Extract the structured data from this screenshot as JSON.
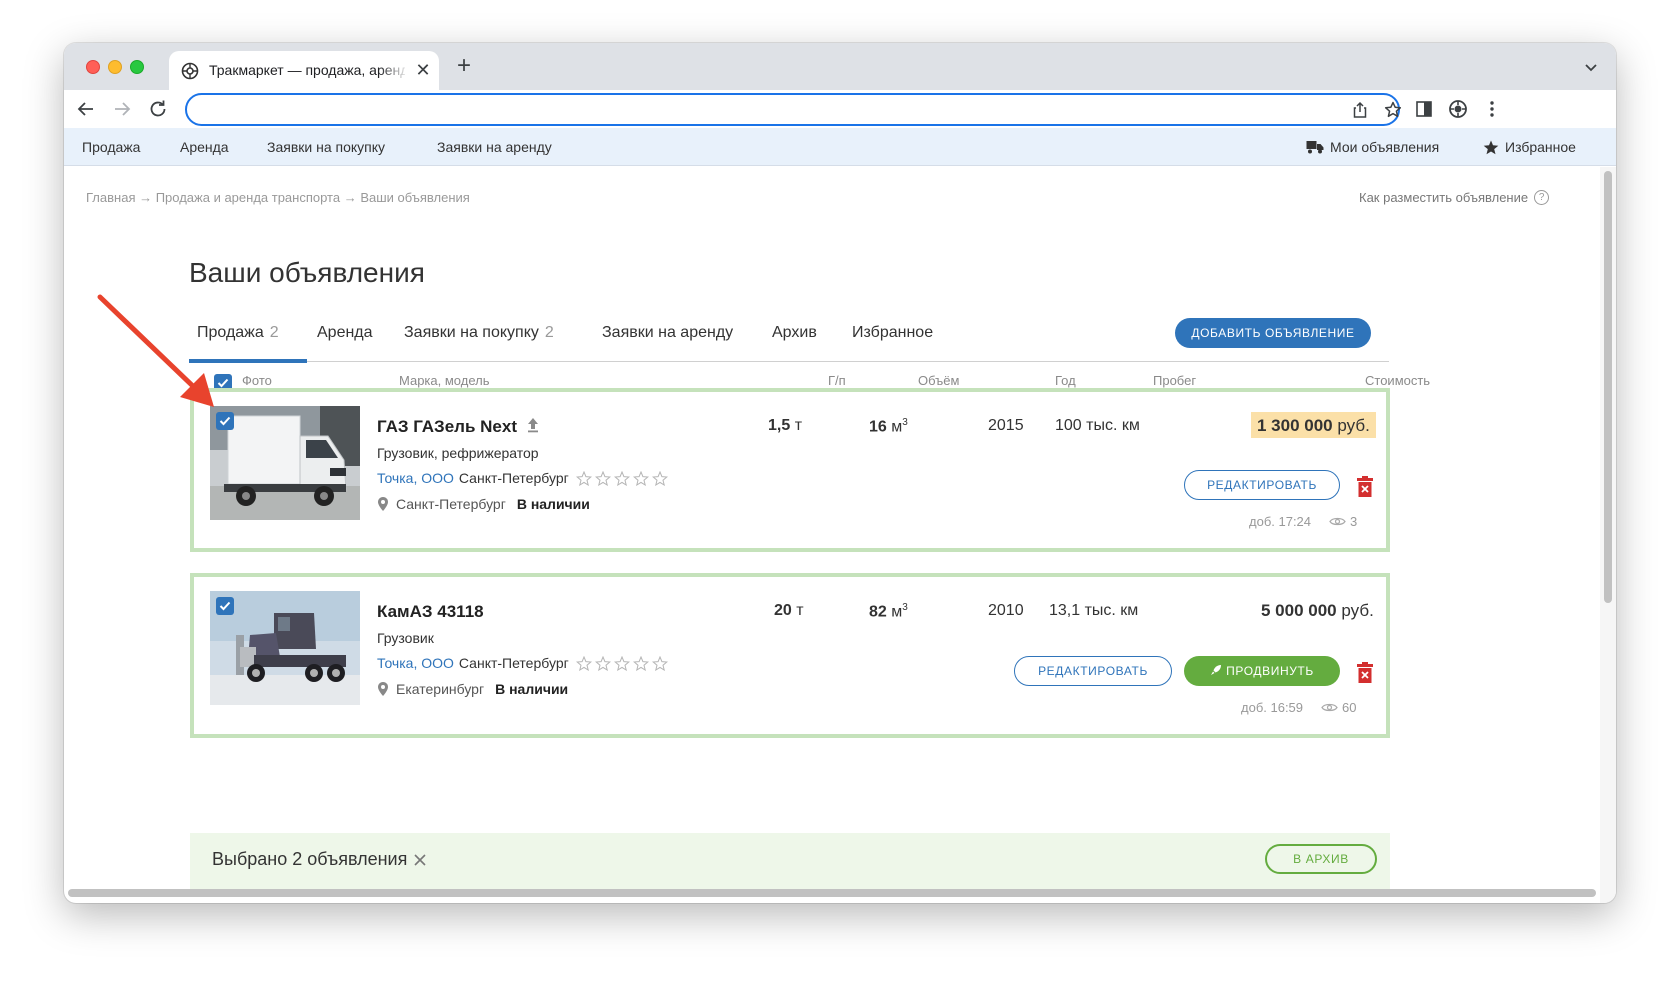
{
  "browser": {
    "tab_title": "Тракмаркет — продажа, аренда",
    "new_tab": "+",
    "close_tab": "✕",
    "address": ""
  },
  "site_nav": {
    "items": [
      "Продажа",
      "Аренда",
      "Заявки на покупку",
      "Заявки на аренду"
    ],
    "my_ads": "Мои объявления",
    "favorites": "Избранное"
  },
  "breadcrumb": "Главная → Продажа и аренда транспорта → Ваши объявления",
  "how_to": "Как разместить объявление",
  "how_to_icon": "?",
  "page_title": "Ваши объявления",
  "tabs": [
    {
      "label": "Продажа",
      "count": "2",
      "active": true
    },
    {
      "label": "Аренда",
      "count": ""
    },
    {
      "label": "Заявки на покупку",
      "count": "2"
    },
    {
      "label": "Заявки на аренду",
      "count": ""
    },
    {
      "label": "Архив",
      "count": ""
    },
    {
      "label": "Избранное",
      "count": ""
    }
  ],
  "add_button": "ДОБАВИТЬ ОБЪЯВЛЕНИЕ",
  "columns": {
    "photo": "Фото",
    "model": "Марка, модель",
    "payload": "Г/п",
    "volume": "Объём",
    "year": "Год",
    "mileage": "Пробег",
    "price": "Стоимость"
  },
  "select_all_checked": true,
  "ads": [
    {
      "title": "ГАЗ ГАЗель Next",
      "subtitle": "Грузовик, рефрижератор",
      "company": "Точка, ООО",
      "seller_city": "Санкт-Петербург",
      "rating": 0,
      "location": "Санкт-Петербург",
      "availability": "В наличии",
      "payload_value": "1,5",
      "payload_unit": "т",
      "volume_value": "16",
      "volume_unit": "м",
      "volume_exp": "3",
      "year": "2015",
      "mileage": "100 тыс. км",
      "price_value": "1 300 000",
      "price_unit": "руб.",
      "edit_label": "РЕДАКТИРОВАТЬ",
      "promote_label": "",
      "added": "доб. 17:24",
      "views": "3",
      "checked": true
    },
    {
      "title": "КамАЗ 43118",
      "subtitle": "Грузовик",
      "company": "Точка, ООО",
      "seller_city": "Санкт-Петербург",
      "rating": 0,
      "location": "Екатеринбург",
      "availability": "В наличии",
      "payload_value": "20",
      "payload_unit": "т",
      "volume_value": "82",
      "volume_unit": "м",
      "volume_exp": "3",
      "year": "2010",
      "mileage": "13,1 тыс. км",
      "price_value": "5 000 000",
      "price_unit": "руб.",
      "edit_label": "РЕДАКТИРОВАТЬ",
      "promote_label": "ПРОДВИНУТЬ",
      "added": "доб. 16:59",
      "views": "60",
      "checked": true
    }
  ],
  "selection_bar": {
    "text": "Выбрано 2 объявления",
    "archive_label": "В АРХИВ"
  },
  "colors": {
    "accent": "#2f74ba",
    "green": "#64ac3f",
    "card_border": "#c5e2bb",
    "price_highlight": "#fbe0a8",
    "annotation": "#e8432d"
  }
}
